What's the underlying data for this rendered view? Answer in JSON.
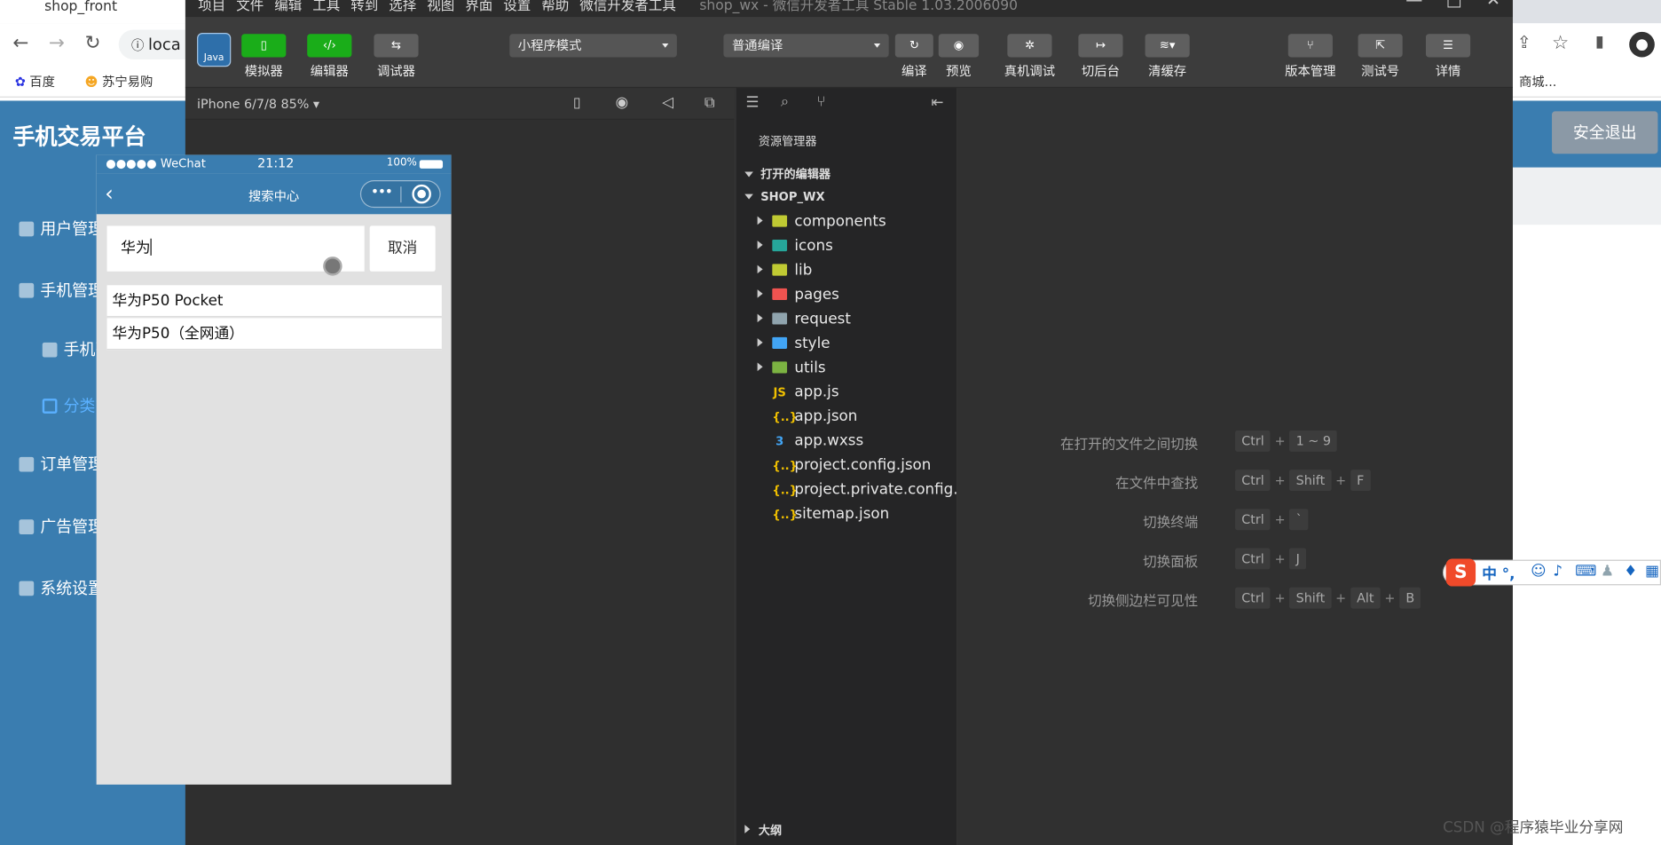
{
  "browser": {
    "tab_title": "shop_front",
    "address_text": "loca",
    "bookmarks": [
      "百度",
      "苏宁易购",
      "商城..."
    ]
  },
  "admin": {
    "title": "手机交易平台",
    "menu": [
      {
        "label": "用户管理"
      },
      {
        "label": "手机管理"
      },
      {
        "label": "手机列表"
      },
      {
        "label": "分类管理"
      },
      {
        "label": "订单管理"
      },
      {
        "label": "广告管理"
      },
      {
        "label": "系统设置"
      }
    ],
    "logout_label": "安全退出"
  },
  "devtools": {
    "menubar": [
      "项目",
      "文件",
      "编辑",
      "工具",
      "转到",
      "选择",
      "视图",
      "界面",
      "设置",
      "帮助",
      "微信开发者工具"
    ],
    "window_title": "shop_wx - 微信开发者工具 Stable 1.03.2006090",
    "toolbar": {
      "simulator": "模拟器",
      "editor": "编辑器",
      "debugger": "调试器",
      "mode_select": "小程序模式",
      "compile_select": "普通编译",
      "compile": "编译",
      "preview": "预览",
      "real_debug": "真机调试",
      "backend": "切后台",
      "clear_cache": "清缓存",
      "version": "版本管理",
      "test_id": "测试号",
      "details": "详情"
    },
    "device_label": "iPhone 6/7/8 85% ▾",
    "phone": {
      "carrier": "●●●●● WeChat",
      "time": "21:12",
      "battery": "100%",
      "nav_title": "搜索中心",
      "search_value": "华为",
      "cancel_label": "取消",
      "results": [
        "华为P50 Pocket",
        "华为P50（全网通）"
      ]
    },
    "explorer": {
      "title": "资源管理器",
      "open_editors": "打开的编辑器",
      "project": "SHOP_WX",
      "outline": "大纲",
      "folders": [
        {
          "name": "components",
          "color": "#c0ca33"
        },
        {
          "name": "icons",
          "color": "#26a69a"
        },
        {
          "name": "lib",
          "color": "#c0ca33"
        },
        {
          "name": "pages",
          "color": "#ef5350"
        },
        {
          "name": "request",
          "color": "#90a4ae"
        },
        {
          "name": "style",
          "color": "#42a5f5"
        },
        {
          "name": "utils",
          "color": "#7cb342"
        }
      ],
      "files": [
        {
          "name": "app.js",
          "icon": "JS",
          "color": "#f0c000"
        },
        {
          "name": "app.json",
          "icon": "{..}",
          "color": "#f0c000"
        },
        {
          "name": "app.wxss",
          "icon": "3",
          "color": "#42a5f5"
        },
        {
          "name": "project.config.json",
          "icon": "{..}",
          "color": "#f0c000"
        },
        {
          "name": "project.private.config...",
          "icon": "{..}",
          "color": "#f0c000"
        },
        {
          "name": "sitemap.json",
          "icon": "{..}",
          "color": "#f0c000"
        }
      ]
    },
    "shortcuts": [
      {
        "label": "在打开的文件之间切换",
        "keys": [
          "Ctrl",
          "1 ~ 9"
        ]
      },
      {
        "label": "在文件中查找",
        "keys": [
          "Ctrl",
          "Shift",
          "F"
        ]
      },
      {
        "label": "切换终端",
        "keys": [
          "Ctrl",
          "`"
        ]
      },
      {
        "label": "切换面板",
        "keys": [
          "Ctrl",
          "J"
        ]
      },
      {
        "label": "切换侧边栏可见性",
        "keys": [
          "Ctrl",
          "Shift",
          "Alt",
          "B"
        ]
      }
    ]
  },
  "ime": {
    "text": "中 °,"
  },
  "watermark": "CSDN @程序猿毕业分享网"
}
